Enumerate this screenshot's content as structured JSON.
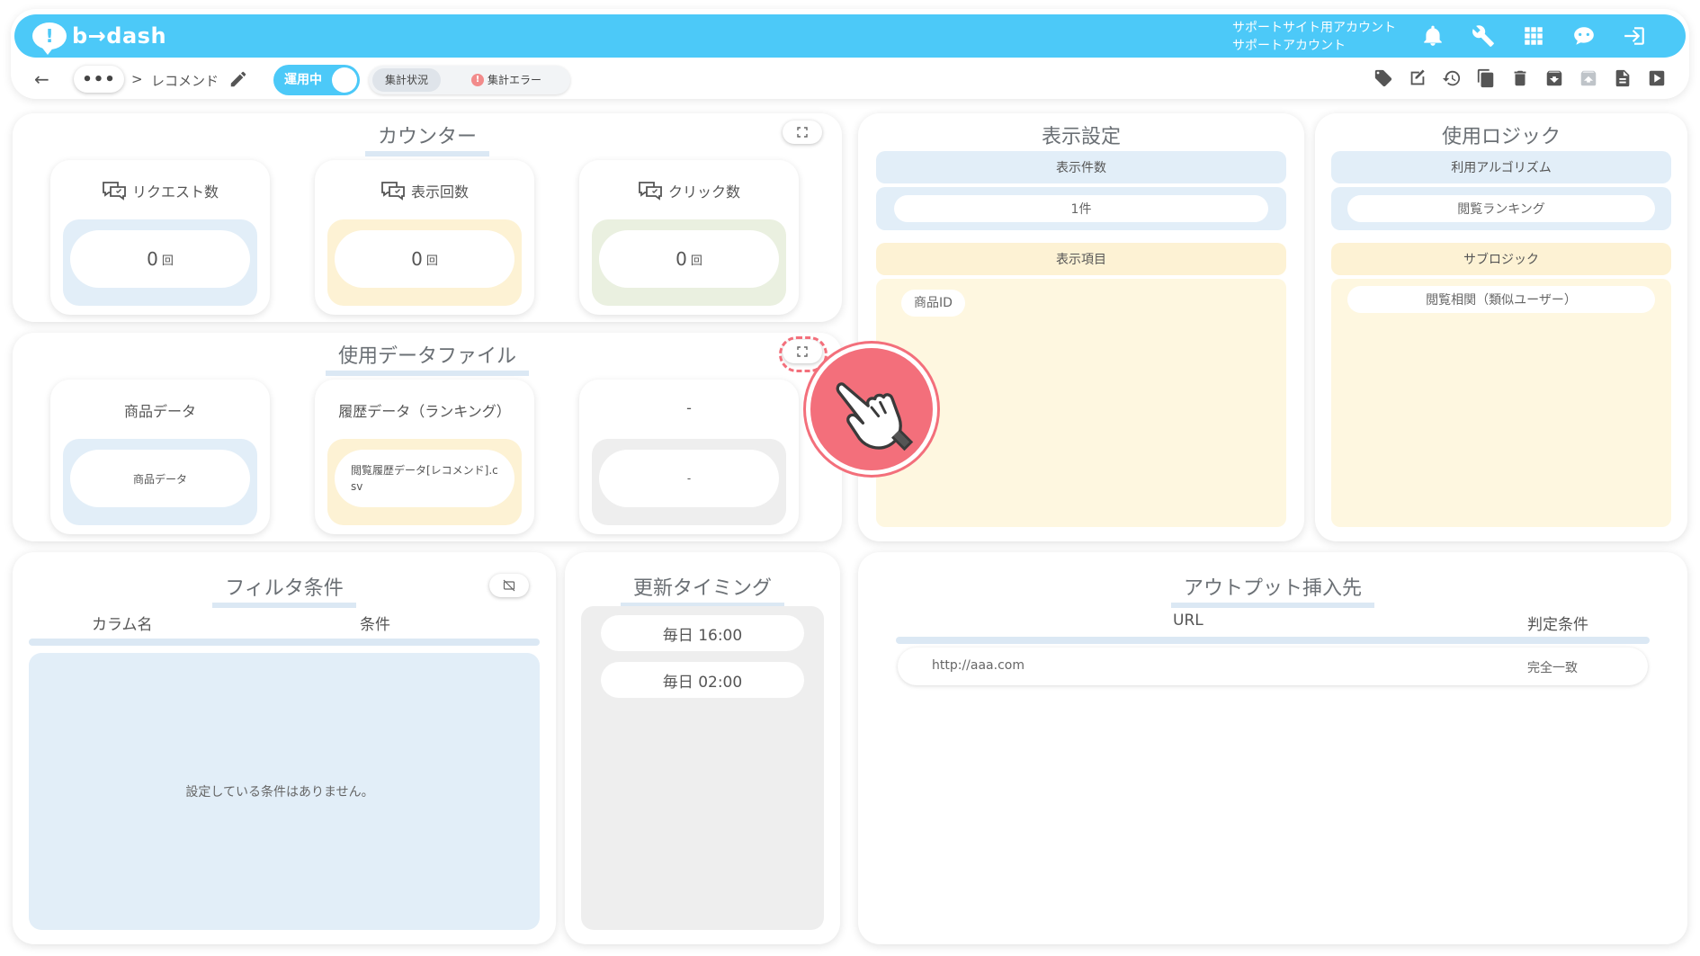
{
  "app": {
    "logo_text": "b→dash",
    "account_line1": "サポートサイト用アカウント",
    "account_line2": "サポートアカウント",
    "top_icons": [
      "bell-icon",
      "wrench-icon",
      "grid-icon",
      "chat-bot-icon",
      "logout-icon"
    ]
  },
  "nav": {
    "back": "←",
    "more": "•••",
    "separator": ">",
    "title": "レコメンド",
    "toggle_label": "運用中",
    "status_tab": "集計状況",
    "error_tab": "集計エラー",
    "error_mark": "!",
    "tools": [
      "tag-icon",
      "edit-icon",
      "history-icon",
      "copy-icon",
      "trash-icon",
      "archive-icon",
      "archive-disabled-icon",
      "document-icon",
      "play-icon"
    ]
  },
  "counter": {
    "title": "カウンター",
    "cards": [
      {
        "label": "リクエスト数",
        "value": "0",
        "unit": "回"
      },
      {
        "label": "表示回数",
        "value": "0",
        "unit": "回"
      },
      {
        "label": "クリック数",
        "value": "0",
        "unit": "回"
      }
    ]
  },
  "data_files": {
    "title": "使用データファイル",
    "cards": [
      {
        "label": "商品データ",
        "value": "商品データ"
      },
      {
        "label": "履歴データ（ランキング）",
        "value": "閲覧履歴データ[レコメンド].csv"
      },
      {
        "label": "-",
        "value": "-"
      }
    ]
  },
  "display_settings": {
    "title": "表示設定",
    "count_header": "表示件数",
    "count_value": "1件",
    "items_header": "表示項目",
    "items": [
      "商品ID"
    ]
  },
  "logic": {
    "title": "使用ロジック",
    "algo_header": "利用アルゴリズム",
    "algo_value": "閲覧ランキング",
    "sub_header": "サブロジック",
    "sub_value": "閲覧相関（類似ユーザー）"
  },
  "filter": {
    "title": "フィルタ条件",
    "col_name": "カラム名",
    "col_cond": "条件",
    "empty": "設定している条件はありません。"
  },
  "timing": {
    "title": "更新タイミング",
    "times": [
      "毎日 16:00",
      "毎日 02:00"
    ]
  },
  "output": {
    "title": "アウトプット挿入先",
    "col_url": "URL",
    "col_cond": "判定条件",
    "rows": [
      {
        "url": "http://aaa.com",
        "cond": "完全一致"
      }
    ]
  }
}
